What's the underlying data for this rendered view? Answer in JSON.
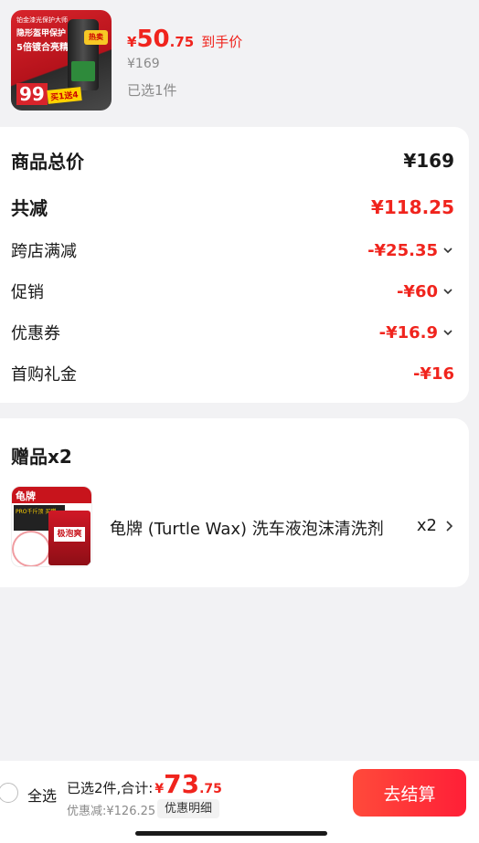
{
  "product": {
    "thumb_line1": "铂金漆光保护大师",
    "thumb_line2": "隐形盔甲保护",
    "thumb_line3": "5倍镀合亮精华",
    "thumb_hot": "热卖",
    "thumb_price": "99",
    "thumb_promo": "买1送4",
    "price_symbol": "¥",
    "price_int": "50",
    "price_dec": ".75",
    "price_tag": "到手价",
    "original_price": "¥169",
    "selected": "已选1件"
  },
  "summary": {
    "total_label": "商品总价",
    "total_value": "¥169",
    "reduce_label": "共减",
    "reduce_value": "¥118.25",
    "items": [
      {
        "label": "跨店满减",
        "value": "-¥25.35",
        "has_chevron": true
      },
      {
        "label": "促销",
        "value": "-¥60",
        "has_chevron": true
      },
      {
        "label": "优惠券",
        "value": "-¥16.9",
        "has_chevron": true
      },
      {
        "label": "首购礼金",
        "value": "-¥16",
        "has_chevron": false
      }
    ]
  },
  "gift": {
    "title": "赠品x2",
    "thumb_brand": "龟牌",
    "thumb_label": "极泡爽",
    "thumb_promo": "PRO千斤顶 买赠",
    "name": "龟牌 (Turtle Wax) 洗车液泡沫清洗剂",
    "qty": "x2"
  },
  "bottom": {
    "select_all": "全选",
    "total_label": "已选2件,合计:",
    "total_symbol": "¥",
    "total_int": "73",
    "total_dec": ".75",
    "discount": "优惠减:¥126.25",
    "detail_button": "优惠明细",
    "checkout_button": "去结算"
  },
  "colors": {
    "accent_red": "#f0241d",
    "background": "#f2f2f4",
    "muted_text": "#8a8a8a"
  }
}
